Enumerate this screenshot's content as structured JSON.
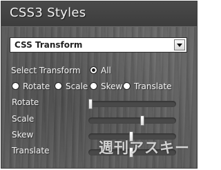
{
  "panel": {
    "title": "CSS3 Styles"
  },
  "dropdown": {
    "selected": "CSS Transform"
  },
  "select_transform": {
    "label": "Select Transform",
    "options": [
      {
        "label": "All",
        "checked": true
      },
      {
        "label": "Rotate",
        "checked": false
      },
      {
        "label": "Scale",
        "checked": false
      },
      {
        "label": "Skew",
        "checked": false
      },
      {
        "label": "Translate",
        "checked": false
      }
    ]
  },
  "sliders": [
    {
      "label": "Rotate",
      "value": 0.0
    },
    {
      "label": "Scale",
      "value": 0.62
    },
    {
      "label": "Skew",
      "value": 0.49
    },
    {
      "label": "Translate",
      "value": 0.49
    }
  ],
  "watermark": {
    "text": "週刊アスキー"
  },
  "icons": {
    "dropdown_arrow": "chevron-down-icon"
  }
}
